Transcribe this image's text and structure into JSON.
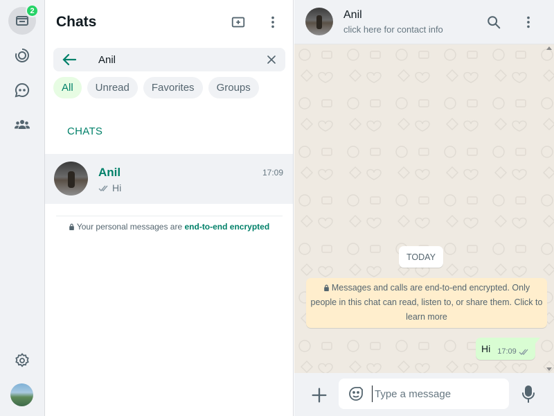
{
  "rail": {
    "chats_badge": "2",
    "items": [
      {
        "icon": "chats-icon",
        "active": true
      },
      {
        "icon": "status-icon",
        "active": false
      },
      {
        "icon": "channels-icon",
        "active": false
      },
      {
        "icon": "communities-icon",
        "active": false
      }
    ],
    "bottom": [
      "settings-icon",
      "profile-avatar"
    ]
  },
  "chat_list": {
    "title": "Chats",
    "search": {
      "value": "Anil"
    },
    "filters": [
      {
        "label": "All",
        "active": true
      },
      {
        "label": "Unread",
        "active": false
      },
      {
        "label": "Favorites",
        "active": false
      },
      {
        "label": "Groups",
        "active": false
      }
    ],
    "section_label": "CHATS",
    "chats": [
      {
        "name": "Anil",
        "time": "17:09",
        "preview": "Hi",
        "status": "delivered"
      }
    ],
    "e2e_note": {
      "text": "Your personal messages are ",
      "link": "end-to-end encrypted"
    }
  },
  "conversation": {
    "contact_name": "Anil",
    "subtitle": "click here for contact info",
    "date_pill": "TODAY",
    "system_message": "Messages and calls are end-to-end encrypted. Only people in this chat can read, listen to, or share them. Click to learn more",
    "messages": [
      {
        "text": "Hi",
        "time": "17:09",
        "outgoing": true,
        "status": "delivered"
      }
    ],
    "composer": {
      "placeholder": "Type a message"
    }
  },
  "colors": {
    "accent": "#008069",
    "badge": "#25d366",
    "outgoing_bubble": "#d9fdd3",
    "system_bubble": "#ffeecd",
    "chat_bg": "#efeae2"
  }
}
